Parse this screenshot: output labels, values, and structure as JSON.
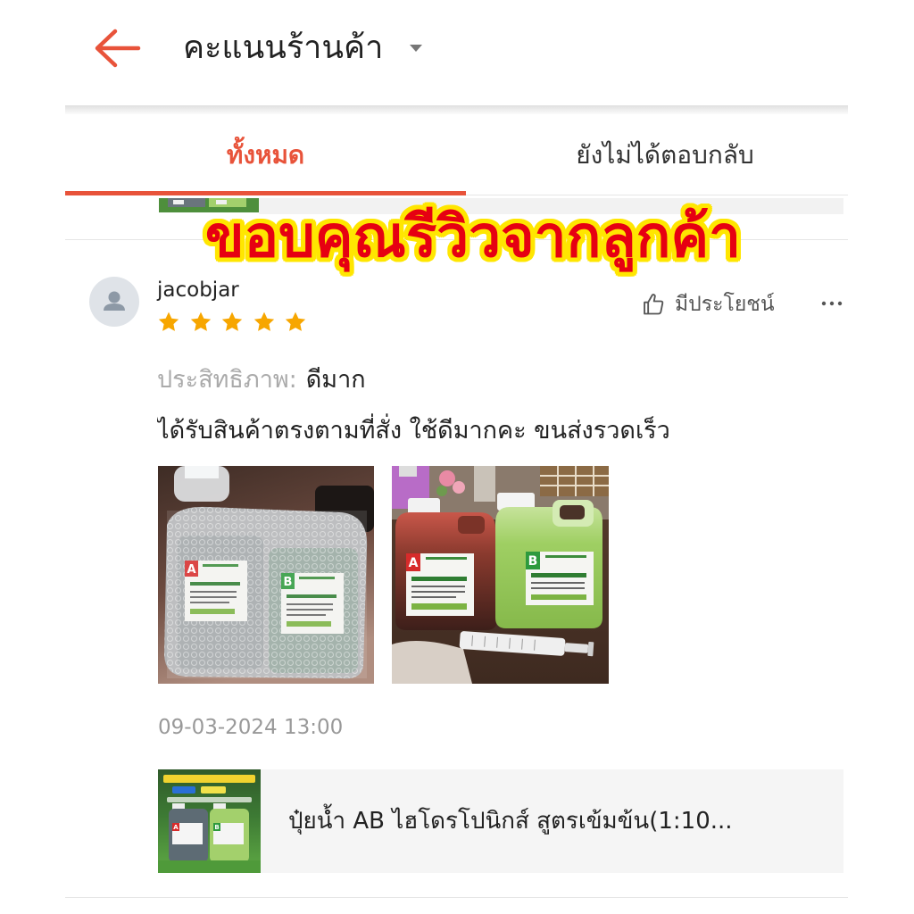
{
  "header": {
    "back_icon": "arrow-left-icon",
    "title": "คะแนนร้านค้า",
    "dropdown_icon": "caret-down-icon"
  },
  "tabs": [
    {
      "label": "ทั้งหมด",
      "active": true
    },
    {
      "label": "ยังไม่ได้ตอบกลับ",
      "active": false
    }
  ],
  "banner": {
    "text": "ขอบคุณรีวิวจากลูกค้า"
  },
  "review": {
    "avatar_icon": "user-icon",
    "username": "jacobjar",
    "rating": 5,
    "rating_max": 5,
    "helpful_icon": "thumbs-up-icon",
    "helpful_label": "มีประโยชน์",
    "more_icon": "more-horizontal-icon",
    "attribute_label": "ประสิทธิภาพ:",
    "attribute_value": "ดีมาก",
    "comment": "ได้รับสินค้าตรงตามที่สั่ง ใช้ดีมากคะ ขนส่งรวดเร็ว",
    "photos": [
      {
        "labels": [
          "A",
          "B"
        ]
      },
      {
        "labels": [
          "A",
          "B"
        ]
      }
    ],
    "timestamp": "09-03-2024 13:00",
    "product": {
      "name": "ปุ๋ยน้ำ AB ไฮโดรโปนิกส์ สูตรเข้มข้น(1:10...",
      "thumb_labels": [
        "A",
        "B"
      ]
    }
  },
  "colors": {
    "accent": "#e8533a",
    "star": "#f7a600",
    "banner_fill": "#e60012",
    "banner_outline": "#ffe600"
  }
}
